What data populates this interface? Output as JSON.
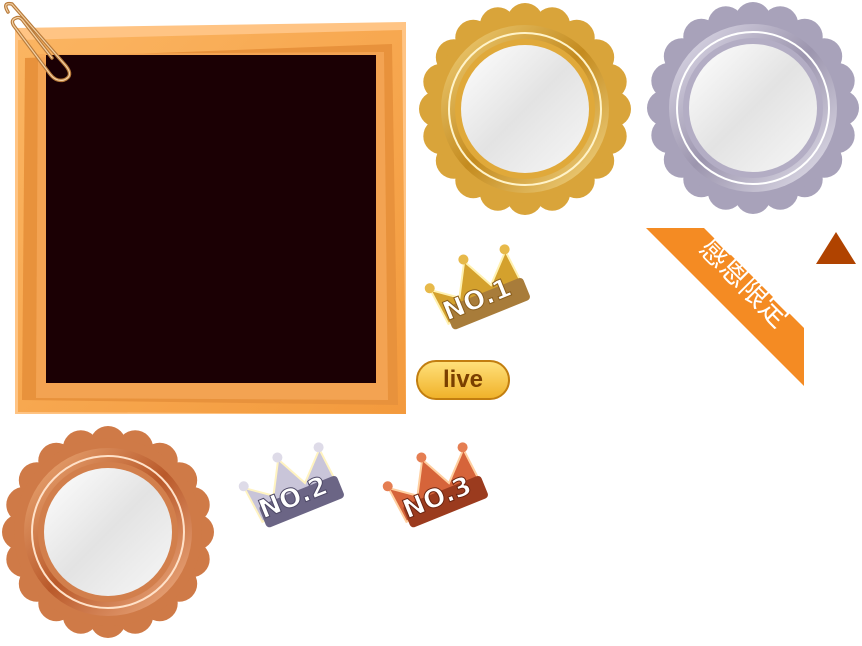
{
  "badges": {
    "live": "live",
    "no1": "NO.1",
    "no2": "NO.2",
    "no3": "NO.3",
    "ribbon": "感恩限定"
  },
  "colors": {
    "frame_orange": "#f7a04a",
    "frame_dark": "#e58d34",
    "photo_black": "#1b0004",
    "gold": "#d9a43a",
    "silver": "#b6b0c6",
    "bronze": "#d17a45",
    "ribbon": "#f48b23",
    "triangle": "#b04300",
    "live_fill": "#f6c43a"
  },
  "icons": [
    "paperclip-icon",
    "crown-gold-icon",
    "crown-silver-icon",
    "crown-bronze-icon",
    "triangle-icon"
  ]
}
